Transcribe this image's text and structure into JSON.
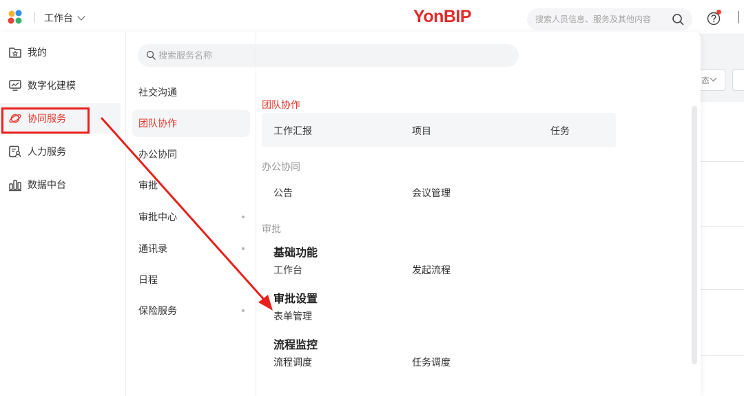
{
  "header": {
    "workbench_label": "工作台",
    "brand": "YonBIP",
    "search_placeholder": "搜索人员信息、服务及其他内容"
  },
  "colors": {
    "brand_red": "#e02a2a",
    "active_red": "#e0352b",
    "annotation_red": "#e8201b"
  },
  "left_nav": {
    "items": [
      {
        "label": "我的",
        "icon": "folder-star-icon"
      },
      {
        "label": "数字化建模",
        "icon": "monitor-chart-icon"
      },
      {
        "label": "协同服务",
        "icon": "planet-icon"
      },
      {
        "label": "人力服务",
        "icon": "person-card-icon"
      },
      {
        "label": "数据中台",
        "icon": "bar-chart-icon"
      }
    ]
  },
  "service_search": {
    "placeholder": "搜索服务名称"
  },
  "categories": {
    "items": [
      {
        "label": "社交沟通"
      },
      {
        "label": "团队协作"
      },
      {
        "label": "办公协同"
      },
      {
        "label": "审批"
      },
      {
        "label": "审批中心"
      },
      {
        "label": "通讯录"
      },
      {
        "label": "日程"
      },
      {
        "label": "保险服务"
      }
    ]
  },
  "content": {
    "team": {
      "title": "团队协作",
      "items": [
        "工作汇报",
        "项目",
        "任务"
      ]
    },
    "office": {
      "title": "办公协同",
      "items": [
        "公告",
        "会议管理"
      ]
    },
    "approval": {
      "title": "审批",
      "groups": [
        {
          "title": "基础功能",
          "items": [
            "工作台",
            "发起流程"
          ]
        },
        {
          "title": "审批设置",
          "items": [
            "表单管理"
          ]
        },
        {
          "title": "流程监控",
          "items": [
            "流程调度",
            "任务调度"
          ]
        }
      ]
    }
  },
  "background_page": {
    "select_fragment": "态"
  }
}
